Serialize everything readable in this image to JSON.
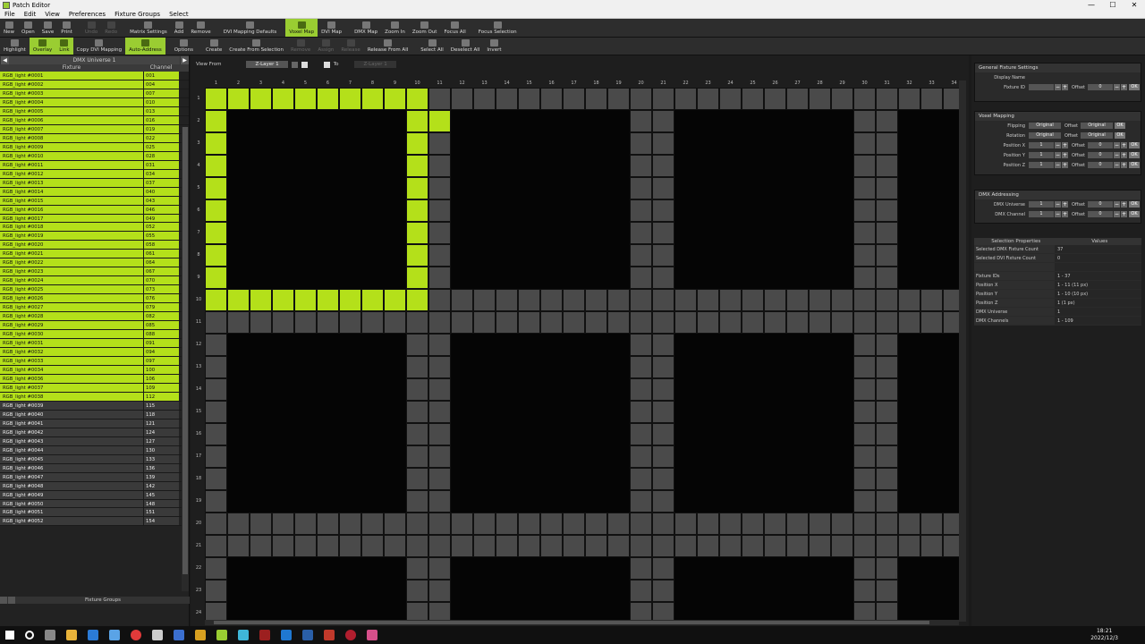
{
  "window": {
    "title": "Patch Editor"
  },
  "menu": [
    "File",
    "Edit",
    "View",
    "Preferences",
    "Fixture Groups",
    "Select"
  ],
  "toolbar1": [
    {
      "label": "New",
      "icon": "new-file-icon"
    },
    {
      "label": "Open",
      "icon": "folder-open-icon"
    },
    {
      "label": "Save",
      "icon": "save-icon"
    },
    {
      "label": "Print",
      "icon": "print-icon"
    },
    {
      "label": "Undo",
      "icon": "undo-icon",
      "disabled": true
    },
    {
      "label": "Redo",
      "icon": "redo-icon",
      "disabled": true
    },
    {
      "label": "Matrix Settings",
      "icon": "matrix-icon"
    },
    {
      "label": "Add",
      "icon": "plus-icon"
    },
    {
      "label": "Remove",
      "icon": "minus-icon"
    },
    {
      "label": "DVI Mapping Defaults",
      "icon": "monitor-icon"
    },
    {
      "label": "Voxel Map",
      "icon": "voxel-icon",
      "active": true
    },
    {
      "label": "DVI Map",
      "icon": "dvi-icon"
    },
    {
      "label": "DMX Map",
      "icon": "dmx-icon"
    },
    {
      "label": "Zoom In",
      "icon": "zoom-in-icon"
    },
    {
      "label": "Zoom Out",
      "icon": "zoom-out-icon"
    },
    {
      "label": "Focus All",
      "icon": "focus-all-icon"
    },
    {
      "label": "Focus Selection",
      "icon": "focus-selection-icon"
    }
  ],
  "toolbar2": [
    {
      "label": "Highlight",
      "icon": "highlight-icon"
    },
    {
      "label": "Overlay",
      "icon": "overlay-icon",
      "active": true
    },
    {
      "label": "Link",
      "icon": "link-icon",
      "active": true
    },
    {
      "label": "Copy DVI Mapping",
      "icon": "copy-icon"
    },
    {
      "label": "Auto-Address",
      "icon": "auto-address-icon",
      "active": true
    },
    {
      "label": "Options",
      "icon": "gear-icon"
    },
    {
      "label": "Create",
      "icon": "create-icon"
    },
    {
      "label": "Create From Selection",
      "icon": "create-selection-icon"
    },
    {
      "label": "Remove",
      "icon": "remove-group-icon",
      "disabled": true
    },
    {
      "label": "Assign",
      "icon": "assign-icon",
      "disabled": true
    },
    {
      "label": "Release",
      "icon": "release-icon",
      "disabled": true
    },
    {
      "label": "Release From All",
      "icon": "release-all-icon"
    },
    {
      "label": "Select All",
      "icon": "select-all-icon"
    },
    {
      "label": "Deselect All",
      "icon": "deselect-all-icon"
    },
    {
      "label": "Invert",
      "icon": "invert-icon"
    }
  ],
  "left": {
    "universe": "DMX Universe 1",
    "col_fixture": "Fixture",
    "col_channel": "Channel",
    "fixtures": [
      [
        "RGB_light #0001",
        "001"
      ],
      [
        "RGB_light #0002",
        "004"
      ],
      [
        "RGB_light #0003",
        "007"
      ],
      [
        "RGB_light #0004",
        "010"
      ],
      [
        "RGB_light #0005",
        "013"
      ],
      [
        "RGB_light #0006",
        "016"
      ],
      [
        "RGB_light #0007",
        "019"
      ],
      [
        "RGB_light #0008",
        "022"
      ],
      [
        "RGB_light #0009",
        "025"
      ],
      [
        "RGB_light #0010",
        "028"
      ],
      [
        "RGB_light #0011",
        "031"
      ],
      [
        "RGB_light #0012",
        "034"
      ],
      [
        "RGB_light #0013",
        "037"
      ],
      [
        "RGB_light #0014",
        "040"
      ],
      [
        "RGB_light #0015",
        "043"
      ],
      [
        "RGB_light #0016",
        "046"
      ],
      [
        "RGB_light #0017",
        "049"
      ],
      [
        "RGB_light #0018",
        "052"
      ],
      [
        "RGB_light #0019",
        "055"
      ],
      [
        "RGB_light #0020",
        "058"
      ],
      [
        "RGB_light #0021",
        "061"
      ],
      [
        "RGB_light #0022",
        "064"
      ],
      [
        "RGB_light #0023",
        "067"
      ],
      [
        "RGB_light #0024",
        "070"
      ],
      [
        "RGB_light #0025",
        "073"
      ],
      [
        "RGB_light #0026",
        "076"
      ],
      [
        "RGB_light #0027",
        "079"
      ],
      [
        "RGB_light #0028",
        "082"
      ],
      [
        "RGB_light #0029",
        "085"
      ],
      [
        "RGB_light #0030",
        "088"
      ],
      [
        "RGB_light #0031",
        "091"
      ],
      [
        "RGB_light #0032",
        "094"
      ],
      [
        "RGB_light #0033",
        "097"
      ],
      [
        "RGB_light #0034",
        "100"
      ],
      [
        "RGB_light #0036",
        "106"
      ],
      [
        "RGB_light #0037",
        "109"
      ],
      [
        "RGB_light #0038",
        "112"
      ],
      [
        "RGB_light #0039",
        "115"
      ],
      [
        "RGB_light #0040",
        "118"
      ],
      [
        "RGB_light #0041",
        "121"
      ],
      [
        "RGB_light #0042",
        "124"
      ],
      [
        "RGB_light #0043",
        "127"
      ],
      [
        "RGB_light #0044",
        "130"
      ],
      [
        "RGB_light #0045",
        "133"
      ],
      [
        "RGB_light #0046",
        "136"
      ],
      [
        "RGB_light #0047",
        "139"
      ],
      [
        "RGB_light #0048",
        "142"
      ],
      [
        "RGB_light #0049",
        "145"
      ],
      [
        "RGB_light #0050",
        "148"
      ],
      [
        "RGB_light #0051",
        "151"
      ],
      [
        "RGB_light #0052",
        "154"
      ]
    ],
    "selected_count": 37,
    "fixture_groups": "Fixture Groups"
  },
  "view": {
    "view_from_label": "View From",
    "view_from_value": "Z-Layer 1",
    "to_label": "To",
    "to_value": "Z-Layer 1"
  },
  "grid": {
    "cols": [
      "1",
      "2",
      "3",
      "4",
      "5",
      "6",
      "7",
      "8",
      "9",
      "10",
      "11",
      "12",
      "13",
      "14",
      "15",
      "16",
      "17",
      "18",
      "19",
      "20",
      "21",
      "22",
      "23",
      "24",
      "25",
      "26",
      "27",
      "28",
      "29",
      "30",
      "31",
      "32",
      "33",
      "34"
    ],
    "rows": [
      "1",
      "2",
      "3",
      "4",
      "5",
      "6",
      "7",
      "8",
      "9",
      "10",
      "11",
      "12",
      "13",
      "14",
      "15",
      "16",
      "17",
      "18",
      "19",
      "20",
      "21",
      "22",
      "23",
      "24"
    ]
  },
  "right": {
    "general_title": "General Fixture Settings",
    "display_name": "Display Name",
    "fixture_id": "Fixture ID",
    "offset": "Offset",
    "ok": "OK",
    "voxel_title": "Voxel Mapping",
    "flipping": "Flipping",
    "rotation": "Rotation",
    "pos_x": "Position X",
    "pos_y": "Position Y",
    "pos_z": "Position Z",
    "original": "Original",
    "dmx_title": "DMX Addressing",
    "dmx_universe": "DMX Universe",
    "dmx_channel": "DMX Channel",
    "one": "1",
    "zero": "0",
    "props_title1": "Selection Properties",
    "props_title2": "Values",
    "props": [
      [
        "Selected DMX Fixture Count",
        "37"
      ],
      [
        "Selected DVI Fixture Count",
        "0"
      ],
      [
        "",
        ""
      ],
      [
        "Fixture IDs",
        "1 - 37"
      ],
      [
        "Position X",
        "1 - 11 (11 px)"
      ],
      [
        "Position Y",
        "1 - 10 (10 px)"
      ],
      [
        "Position Z",
        "1 (1 px)"
      ],
      [
        "DMX Universe",
        "1"
      ],
      [
        "DMX Channels",
        "1 - 109"
      ]
    ]
  },
  "clock": {
    "time": "18:21",
    "date": "2022/12/3"
  }
}
